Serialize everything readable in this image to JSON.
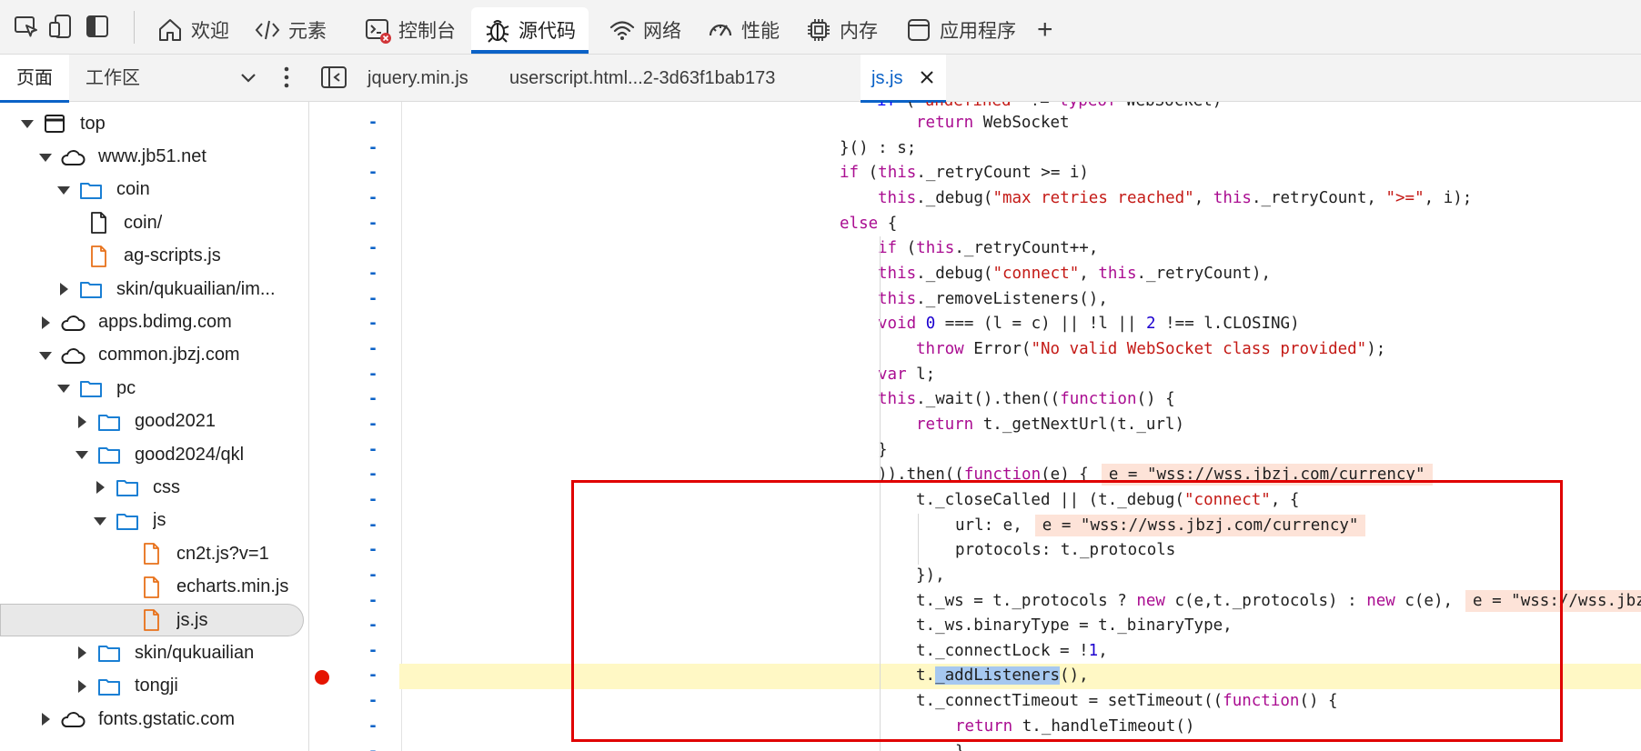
{
  "toolbar": {
    "left_icons": [
      "inspect-icon",
      "device-emulation-icon",
      "dock-icon"
    ],
    "tabs": [
      {
        "label": "欢迎",
        "icon": "home-icon"
      },
      {
        "label": "元素",
        "icon": "code-icon"
      },
      {
        "label": "控制台",
        "icon": "console-icon"
      },
      {
        "label": "源代码",
        "icon": "bug-icon"
      },
      {
        "label": "网络",
        "icon": "wifi-icon"
      },
      {
        "label": "性能",
        "icon": "gauge-icon"
      },
      {
        "label": "内存",
        "icon": "chip-icon"
      },
      {
        "label": "应用程序",
        "icon": "app-window-icon"
      }
    ],
    "active_tab": "源代码",
    "add_label": "+"
  },
  "navigator": {
    "tabs": [
      {
        "label": "页面"
      },
      {
        "label": "工作区"
      }
    ],
    "active_tab": "页面",
    "tree": [
      {
        "label": "top",
        "icon": "frame-icon"
      },
      {
        "label": "www.jb51.net",
        "icon": "cloud-icon"
      },
      {
        "label": "coin",
        "icon": "folder-icon"
      },
      {
        "label": "coin/",
        "icon": "file-icon"
      },
      {
        "label": "ag-scripts.js",
        "icon": "script-file-icon"
      },
      {
        "label": "skin/qukuailian/im...",
        "icon": "folder-icon"
      },
      {
        "label": "apps.bdimg.com",
        "icon": "cloud-icon"
      },
      {
        "label": "common.jbzj.com",
        "icon": "cloud-icon"
      },
      {
        "label": "pc",
        "icon": "folder-icon"
      },
      {
        "label": "good2021",
        "icon": "folder-icon"
      },
      {
        "label": "good2024/qkl",
        "icon": "folder-icon"
      },
      {
        "label": "css",
        "icon": "folder-icon"
      },
      {
        "label": "js",
        "icon": "folder-icon"
      },
      {
        "label": "cn2t.js?v=1",
        "icon": "script-file-icon"
      },
      {
        "label": "echarts.min.js",
        "icon": "script-file-icon"
      },
      {
        "label": "js.js",
        "icon": "script-file-icon",
        "selected": true
      },
      {
        "label": "skin/qukuailian",
        "icon": "folder-icon"
      },
      {
        "label": "tongji",
        "icon": "folder-icon"
      },
      {
        "label": "fonts.gstatic.com",
        "icon": "cloud-icon"
      }
    ]
  },
  "editor": {
    "file_tabs": [
      {
        "label": "jquery.min.js"
      },
      {
        "label": "userscript.html...2-3d63f1bab173"
      },
      {
        "label": "js.js",
        "active": true
      }
    ],
    "gutter_mark": "-",
    "inline_value": "e = \"wss://wss.jbzj.com/currency\"",
    "code": [
      "    return WebSocket",
      "}() : s;",
      "if (this._retryCount >= i)",
      "    this._debug(\"max retries reached\", this._retryCount, \">=\", i);",
      "else {",
      "    if (this._retryCount++,",
      "    this._debug(\"connect\", this._retryCount),",
      "    this._removeListeners(),",
      "    void 0 === (l = c) || !l || 2 !== l.CLOSING)",
      "        throw Error(\"No valid WebSocket class provided\");",
      "    var l;",
      "    this._wait().then((function() {",
      "        return t._getNextUrl(t._url)",
      "    }",
      "    )).then((function(e) {",
      "        t._closeCalled || (t._debug(\"connect\", {",
      "            url: e,",
      "            protocols: t._protocols",
      "        }),",
      "        t._ws = t._protocols ? new c(e,t._protocols) : new c(e),",
      "        t._ws.binaryType = t._binaryType,",
      "        t._connectLock = !1,",
      "        t._addListeners(),",
      "        t._connectTimeout = setTimeout((function() {",
      "            return t._handleTimeout()"
    ]
  }
}
